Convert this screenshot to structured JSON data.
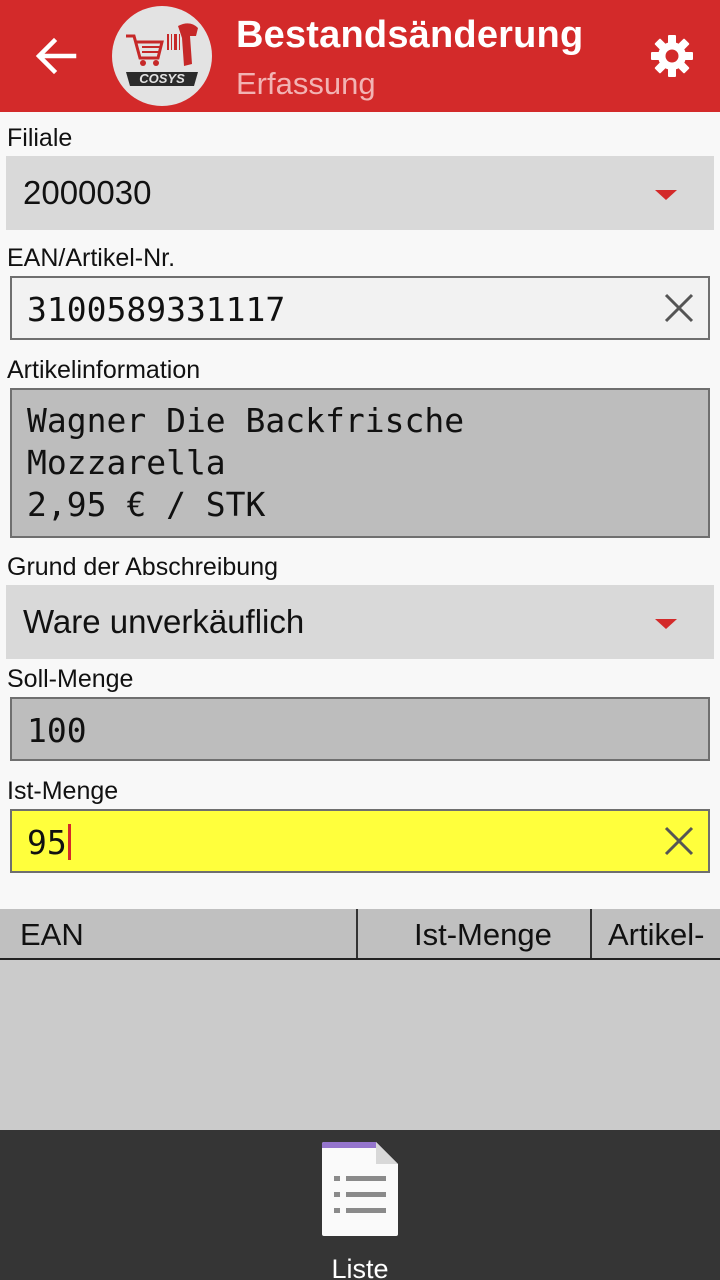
{
  "appbar": {
    "title": "Bestandsänderung",
    "subtitle": "Erfassung",
    "back_icon": "arrow-left-icon",
    "settings_icon": "gear-icon",
    "logo_text": "COSYS"
  },
  "form": {
    "filiale": {
      "label": "Filiale",
      "value": "2000030"
    },
    "ean": {
      "label": "EAN/Artikel-Nr.",
      "value": "3100589331117"
    },
    "artikelinfo": {
      "label": "Artikelinformation",
      "line1": "Wagner Die Backfrische",
      "line2": "Mozzarella",
      "line3": "2,95 € / STK"
    },
    "grund": {
      "label": "Grund der Abschreibung",
      "value": "Ware unverkäuflich"
    },
    "soll": {
      "label": "Soll-Menge",
      "value": "100"
    },
    "ist": {
      "label": "Ist-Menge",
      "value": "95"
    }
  },
  "table": {
    "columns": [
      "EAN",
      "Ist-Menge",
      "Artikel-"
    ]
  },
  "bottombar": {
    "list_label": "Liste",
    "list_icon": "document-list-icon"
  },
  "colors": {
    "appbar": "#d32a2a",
    "highlight_field": "#ffff3c",
    "bottombar": "#353535"
  }
}
